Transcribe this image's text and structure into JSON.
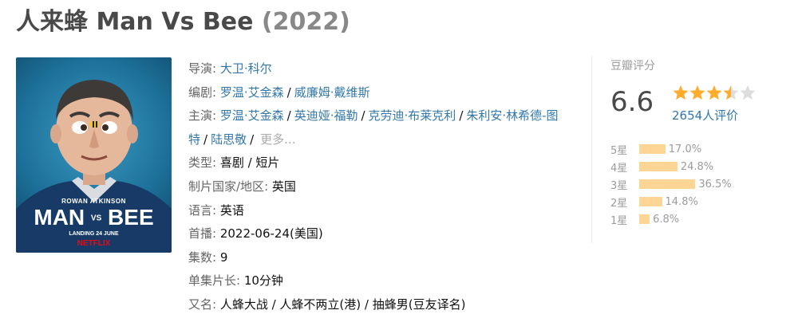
{
  "title": {
    "cn": "人来蜂",
    "en": "Man Vs Bee",
    "year": "(2022)"
  },
  "poster": {
    "actor": "ROWAN ATKINSON",
    "title_left": "MAN",
    "title_vs": "VS",
    "title_right": "BEE",
    "tagline": "LANDING 24 JUNE",
    "brand": "NETFLIX",
    "brand_color": "#e50914",
    "bg_color": "#1c6f98"
  },
  "info": {
    "director": {
      "label": "导演",
      "names": [
        "大卫·科尔"
      ]
    },
    "writer": {
      "label": "编剧",
      "names": [
        "罗温·艾金森",
        "威廉姆·戴维斯"
      ]
    },
    "cast": {
      "label": "主演",
      "names": [
        "罗温·艾金森",
        "英迪娅·福勒",
        "克劳迪·布莱克利",
        "朱利安·林希德-图特",
        "陆思敬"
      ],
      "more": "更多..."
    },
    "genre": {
      "label": "类型",
      "value": "喜剧 / 短片"
    },
    "country": {
      "label": "制片国家/地区",
      "value": "英国"
    },
    "language": {
      "label": "语言",
      "value": "英语"
    },
    "premiere": {
      "label": "首播",
      "value": "2022-06-24(美国)"
    },
    "episodes": {
      "label": "集数",
      "value": "9"
    },
    "runtime": {
      "label": "单集片长",
      "value": "10分钟"
    },
    "aka": {
      "label": "又名",
      "value": "人蜂大战 / 人蜂不两立(港) / 抽蜂男(豆友译名)"
    }
  },
  "rating": {
    "label": "豆瓣评分",
    "score": "6.6",
    "stars": 3.5,
    "count": "2654人评价",
    "star_color": "#ffac2d",
    "bar_color": "#ffd596",
    "breakdown": [
      {
        "label": "5星",
        "percent": 17.0,
        "text": "17.0%"
      },
      {
        "label": "4星",
        "percent": 24.8,
        "text": "24.8%"
      },
      {
        "label": "3星",
        "percent": 36.5,
        "text": "36.5%"
      },
      {
        "label": "2星",
        "percent": 14.8,
        "text": "14.8%"
      },
      {
        "label": "1星",
        "percent": 6.8,
        "text": "6.8%"
      }
    ]
  }
}
